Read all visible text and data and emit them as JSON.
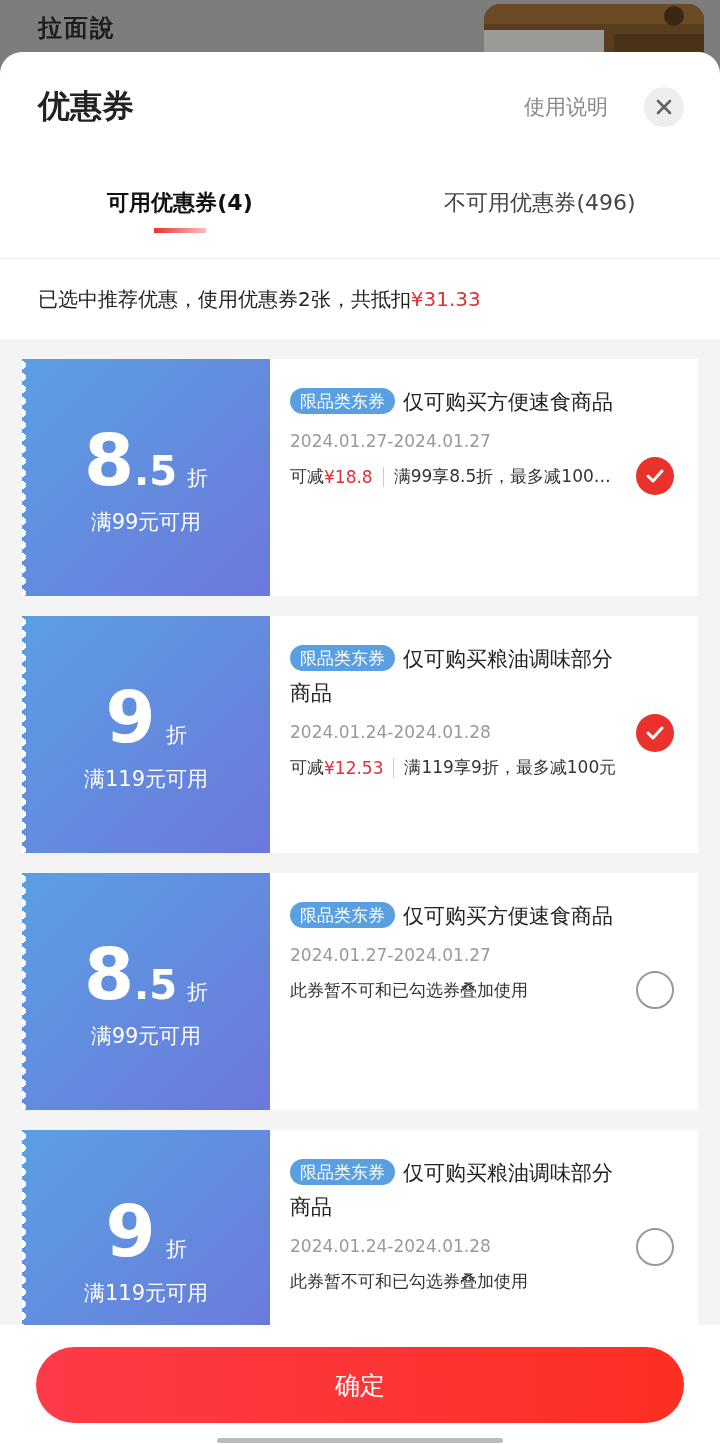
{
  "background": {
    "logo": "拉面說"
  },
  "sheet": {
    "title": "优惠券",
    "help_link": "使用说明",
    "tabs": [
      {
        "label": "可用优惠券(4)",
        "selected": true
      },
      {
        "label": "不可用优惠券(496)",
        "selected": false
      }
    ],
    "summary": {
      "text": "已选中推荐优惠，使用优惠券2张，共抵扣",
      "amount": "¥31.33"
    },
    "coupons": [
      {
        "value": "8",
        "decimal": ".5",
        "unit": "折",
        "condition": "满99元可用",
        "tag": "限品类东券",
        "title": "仅可购买方便速食商品",
        "dates": "2024.01.27-2024.01.27",
        "selected": true,
        "savings_label": "可减",
        "savings": "¥18.8",
        "rule": "满99享8.5折，最多减100…"
      },
      {
        "value": "9",
        "unit": "折",
        "condition": "满119元可用",
        "tag": "限品类东券",
        "title": "仅可购买粮油调味部分商品",
        "dates": "2024.01.24-2024.01.28",
        "selected": true,
        "savings_label": "可减",
        "savings": "¥12.53",
        "rule": "满119享9折，最多减100元"
      },
      {
        "value": "8",
        "decimal": ".5",
        "unit": "折",
        "condition": "满99元可用",
        "tag": "限品类东券",
        "title": "仅可购买方便速食商品",
        "dates": "2024.01.27-2024.01.27",
        "selected": false,
        "note": "此券暂不可和已勾选券叠加使用"
      },
      {
        "value": "9",
        "unit": "折",
        "condition": "满119元可用",
        "tag": "限品类东券",
        "title": "仅可购买粮油调味部分商品",
        "dates": "2024.01.24-2024.01.28",
        "selected": false,
        "note": "此券暂不可和已勾选券叠加使用"
      }
    ],
    "confirm_button": "确定"
  }
}
